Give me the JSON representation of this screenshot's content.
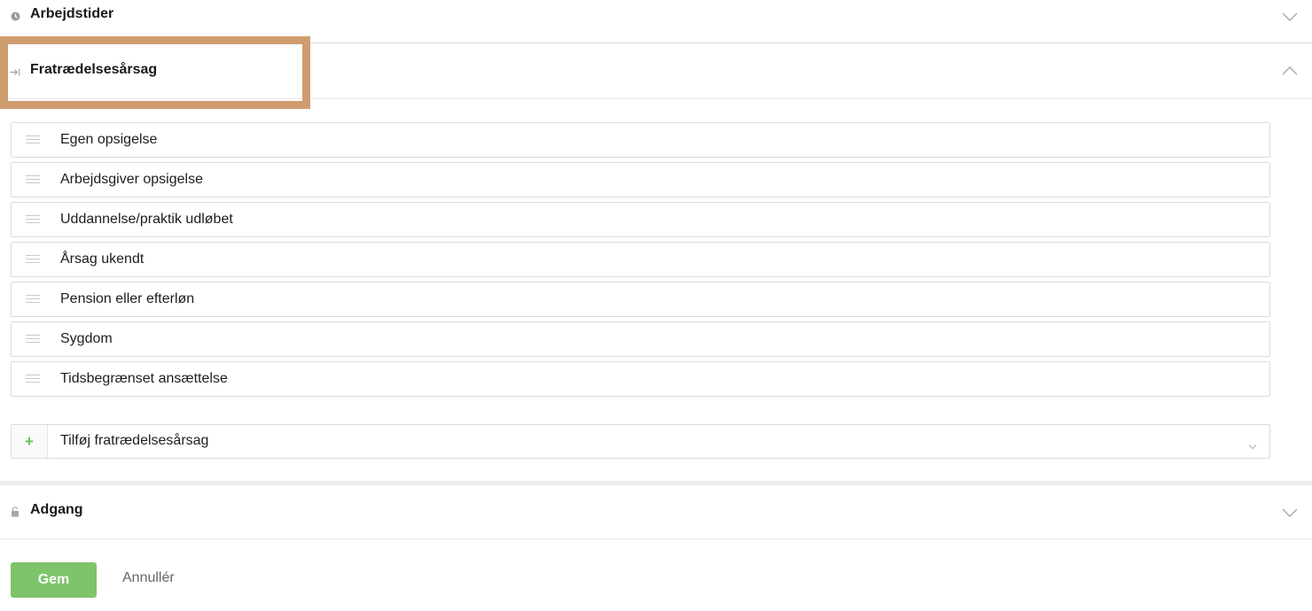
{
  "sections": {
    "arbejdstider": {
      "title": "Arbejdstider",
      "icon": "clock-icon"
    },
    "fratraedelsesaarsag": {
      "title": "Fratrædelsesårsag",
      "icon": "exit-arrow-icon"
    },
    "adgang": {
      "title": "Adgang",
      "icon": "lock-icon"
    }
  },
  "reasons": [
    "Egen opsigelse",
    "Arbejdsgiver opsigelse",
    "Uddannelse/praktik udløbet",
    "Årsag ukendt",
    "Pension eller efterløn",
    "Sygdom",
    "Tidsbegrænset ansættelse"
  ],
  "add_reason": {
    "icon": "plus-icon",
    "plus_symbol": "+",
    "label": "Tilføj fratrædelsesårsag"
  },
  "actions": {
    "save_label": "Gem",
    "cancel_label": "Annullér"
  },
  "colors": {
    "highlight": "#cf9c6e",
    "save_button": "#7ec46a",
    "plus": "#6bbf59"
  }
}
